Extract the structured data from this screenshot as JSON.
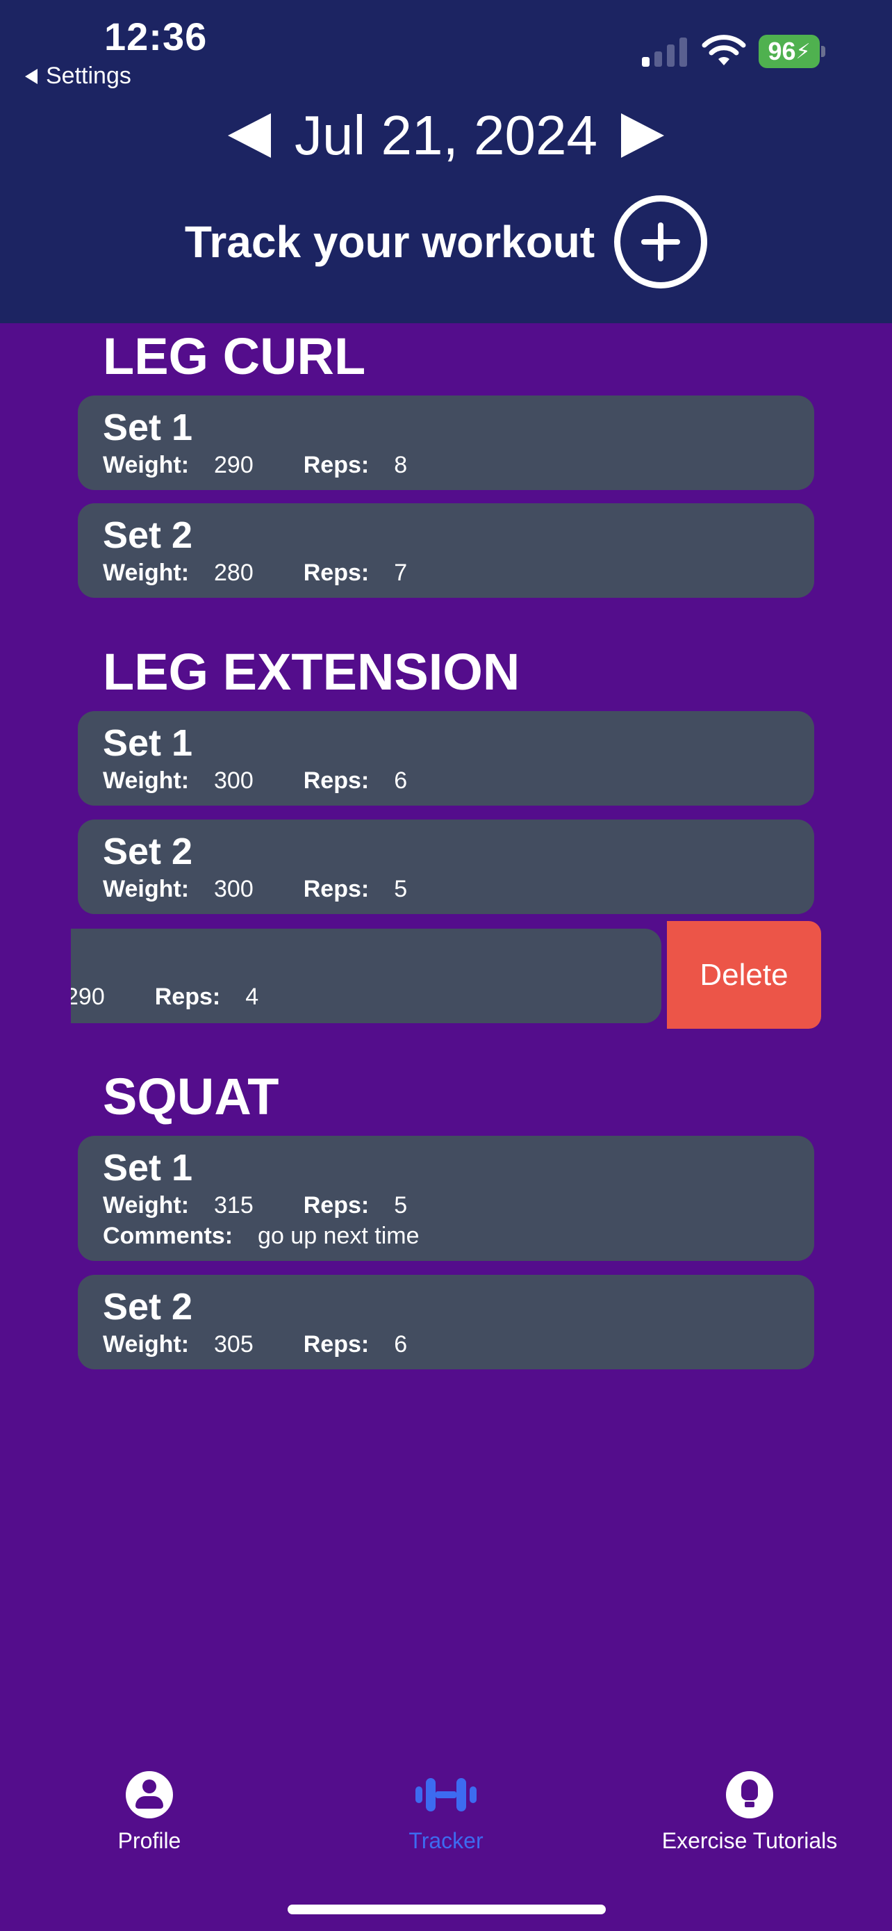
{
  "status_bar": {
    "time": "12:36",
    "back_label": "Settings",
    "battery": "96"
  },
  "header": {
    "date": "Jul 21, 2024",
    "track_label": "Track your workout"
  },
  "exercises": [
    {
      "name": "LEG CURL",
      "sets": [
        {
          "title": "Set 1",
          "weight": "290",
          "reps": "8"
        },
        {
          "title": "Set 2",
          "weight": "280",
          "reps": "7"
        }
      ]
    },
    {
      "name": "LEG EXTENSION",
      "sets": [
        {
          "title": "Set 1",
          "weight": "300",
          "reps": "6"
        },
        {
          "title": "Set 2",
          "weight": "300",
          "reps": "5"
        },
        {
          "title": "",
          "weight": "290",
          "reps": "4"
        }
      ]
    },
    {
      "name": "SQUAT",
      "sets": [
        {
          "title": "Set 1",
          "weight": "315",
          "reps": "5",
          "comments": "go up next time"
        },
        {
          "title": "Set 2",
          "weight": "305",
          "reps": "6"
        }
      ]
    }
  ],
  "labels": {
    "weight": "Weight:",
    "reps": "Reps:",
    "comments": "Comments:",
    "delete": "Delete"
  },
  "tabs": [
    {
      "label": "Profile",
      "icon": "person-icon"
    },
    {
      "label": "Tracker",
      "icon": "dumbbell-icon",
      "active": true
    },
    {
      "label": "Exercise Tutorials",
      "icon": "lightbulb-icon"
    }
  ],
  "colors": {
    "header_bg": "#1c2462",
    "page_bg": "#540d8c",
    "card_bg": "#434d60",
    "delete_bg": "#ec5548",
    "active_tab": "#3d6bf0"
  }
}
